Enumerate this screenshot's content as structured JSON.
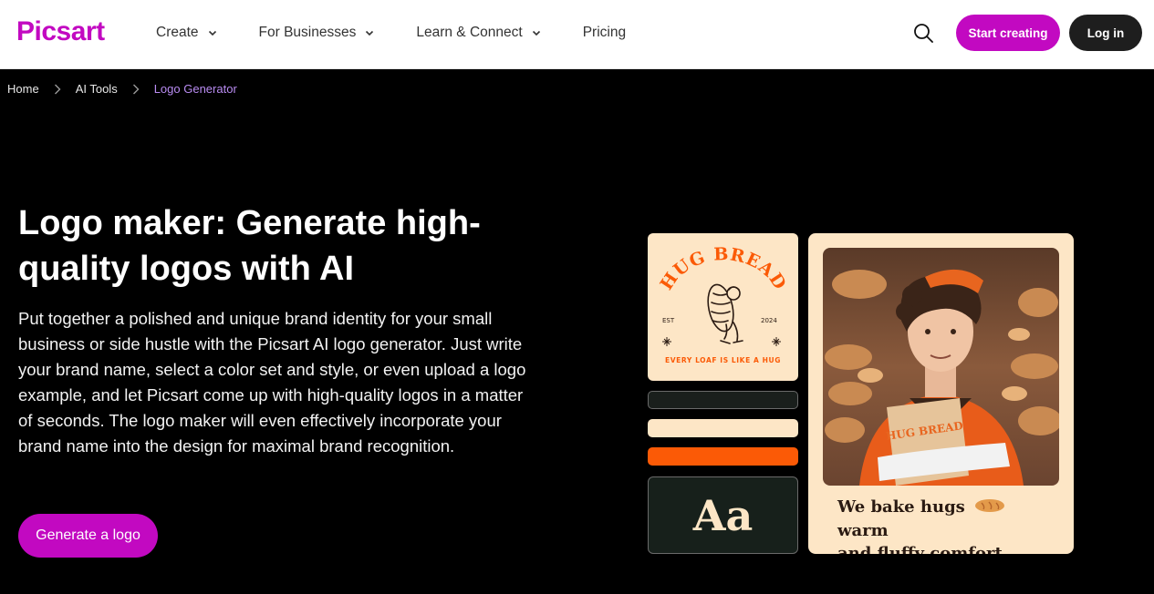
{
  "header": {
    "logo": "Picsart",
    "nav": [
      {
        "label": "Create",
        "has_dropdown": true
      },
      {
        "label": "For Businesses",
        "has_dropdown": true
      },
      {
        "label": "Learn & Connect",
        "has_dropdown": true
      },
      {
        "label": "Pricing",
        "has_dropdown": false
      }
    ],
    "search_icon": "search-icon",
    "start_label": "Start creating",
    "login_label": "Log in"
  },
  "breadcrumb": {
    "items": [
      "Home",
      "AI Tools"
    ],
    "current": "Logo Generator"
  },
  "hero": {
    "title": "Logo maker: Generate high-quality logos with AI",
    "description": "Put together a polished and unique brand identity for your small business or side hustle with the Picsart AI logo generator. Just write your brand name, select a color set and style, or even upload a logo example, and let Picsart come up with high-quality logos in a matter of seconds. The logo maker will even effectively incorporate your brand name into the design for maximal brand recognition.",
    "cta_label": "Generate a logo"
  },
  "showcase": {
    "logo_card": {
      "brand": "HUG BREAD",
      "est": "EST",
      "year": "2024",
      "slogan": "EVERY LOAF IS LIKE A HUG"
    },
    "font_sample": "Aa",
    "tagline_line1": "We bake hugs",
    "tagline_word_warm": "warm",
    "tagline_line2": "and fluffy comfort",
    "colors": {
      "cream": "#fde6c6",
      "orange": "#fb5a06",
      "dark": "#1a1f1c",
      "brand_purple": "#c209c1"
    }
  }
}
